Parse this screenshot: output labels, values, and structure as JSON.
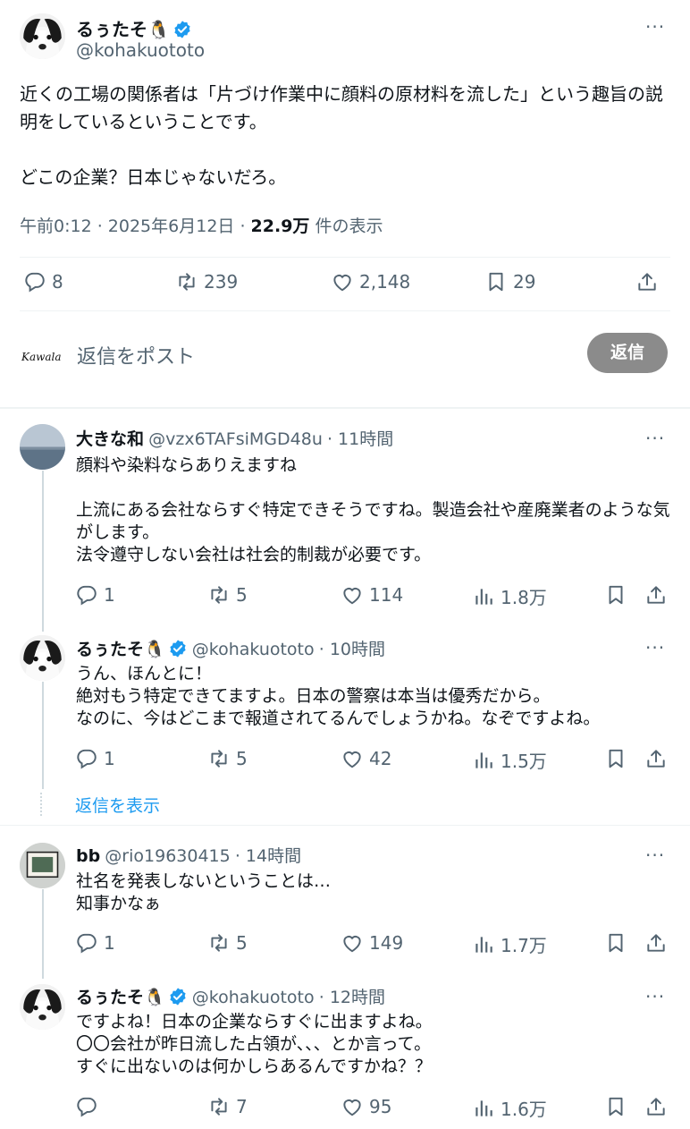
{
  "main_tweet": {
    "name": "るぅたそ🐧",
    "handle": "@kohakuototo",
    "text": "近くの工場の関係者は「片づけ作業中に顔料の原材料を流した」という趣旨の説明をしているということです。\n\nどこの企業？日本じゃないだろ。",
    "time": "午前0:12 · 2025年6月12日 · ",
    "views_count": "22.9万",
    "views_label": " 件の表示",
    "replies": "8",
    "retweets": "239",
    "likes": "2,148",
    "bookmarks": "29"
  },
  "compose": {
    "logo_text": "Kawala",
    "placeholder": "返信をポスト",
    "reply_button": "返信"
  },
  "replies": [
    {
      "name": "大きな和",
      "handle": "@vzx6TAFsiMGD48u",
      "time": "· 11時間",
      "text": "顔料や染料ならありえますね\n\n上流にある会社ならすぐ特定できそうですね。製造会社や産廃業者のような気がします。\n法令遵守しない会社は社会的制裁が必要です。",
      "replies": "1",
      "retweets": "5",
      "likes": "114",
      "views": "1.8万"
    },
    {
      "name": "るぅたそ🐧",
      "handle": "@kohakuototo",
      "time": "· 10時間",
      "text": "うん、ほんとに！\n絶対もう特定できてますよ。日本の警察は本当は優秀だから。\nなのに、今はどこまで報道されてるんでしょうかね。なぞですよね。",
      "replies": "1",
      "retweets": "5",
      "likes": "42",
      "views": "1.5万"
    },
    {
      "name": "bb",
      "handle": "@rio19630415",
      "time": "· 14時間",
      "text": "社名を発表しないということは…\n知事かなぁ",
      "replies": "1",
      "retweets": "5",
      "likes": "149",
      "views": "1.7万"
    },
    {
      "name": "るぅたそ🐧",
      "handle": "@kohakuototo",
      "time": "· 12時間",
      "text": "ですよね！日本の企業ならすぐに出ますよね。\n〇〇会社が昨日流した占領が、、、とか言って。\nすぐに出ないのは何かしらあるんですかね？？",
      "replies": "",
      "retweets": "7",
      "likes": "95",
      "views": "1.6万"
    }
  ],
  "show_replies_label": "返信を表示",
  "more_label": "···",
  "colors": {
    "verified": "#1d9bf0",
    "link": "#1d9bf0",
    "muted": "#536471"
  }
}
